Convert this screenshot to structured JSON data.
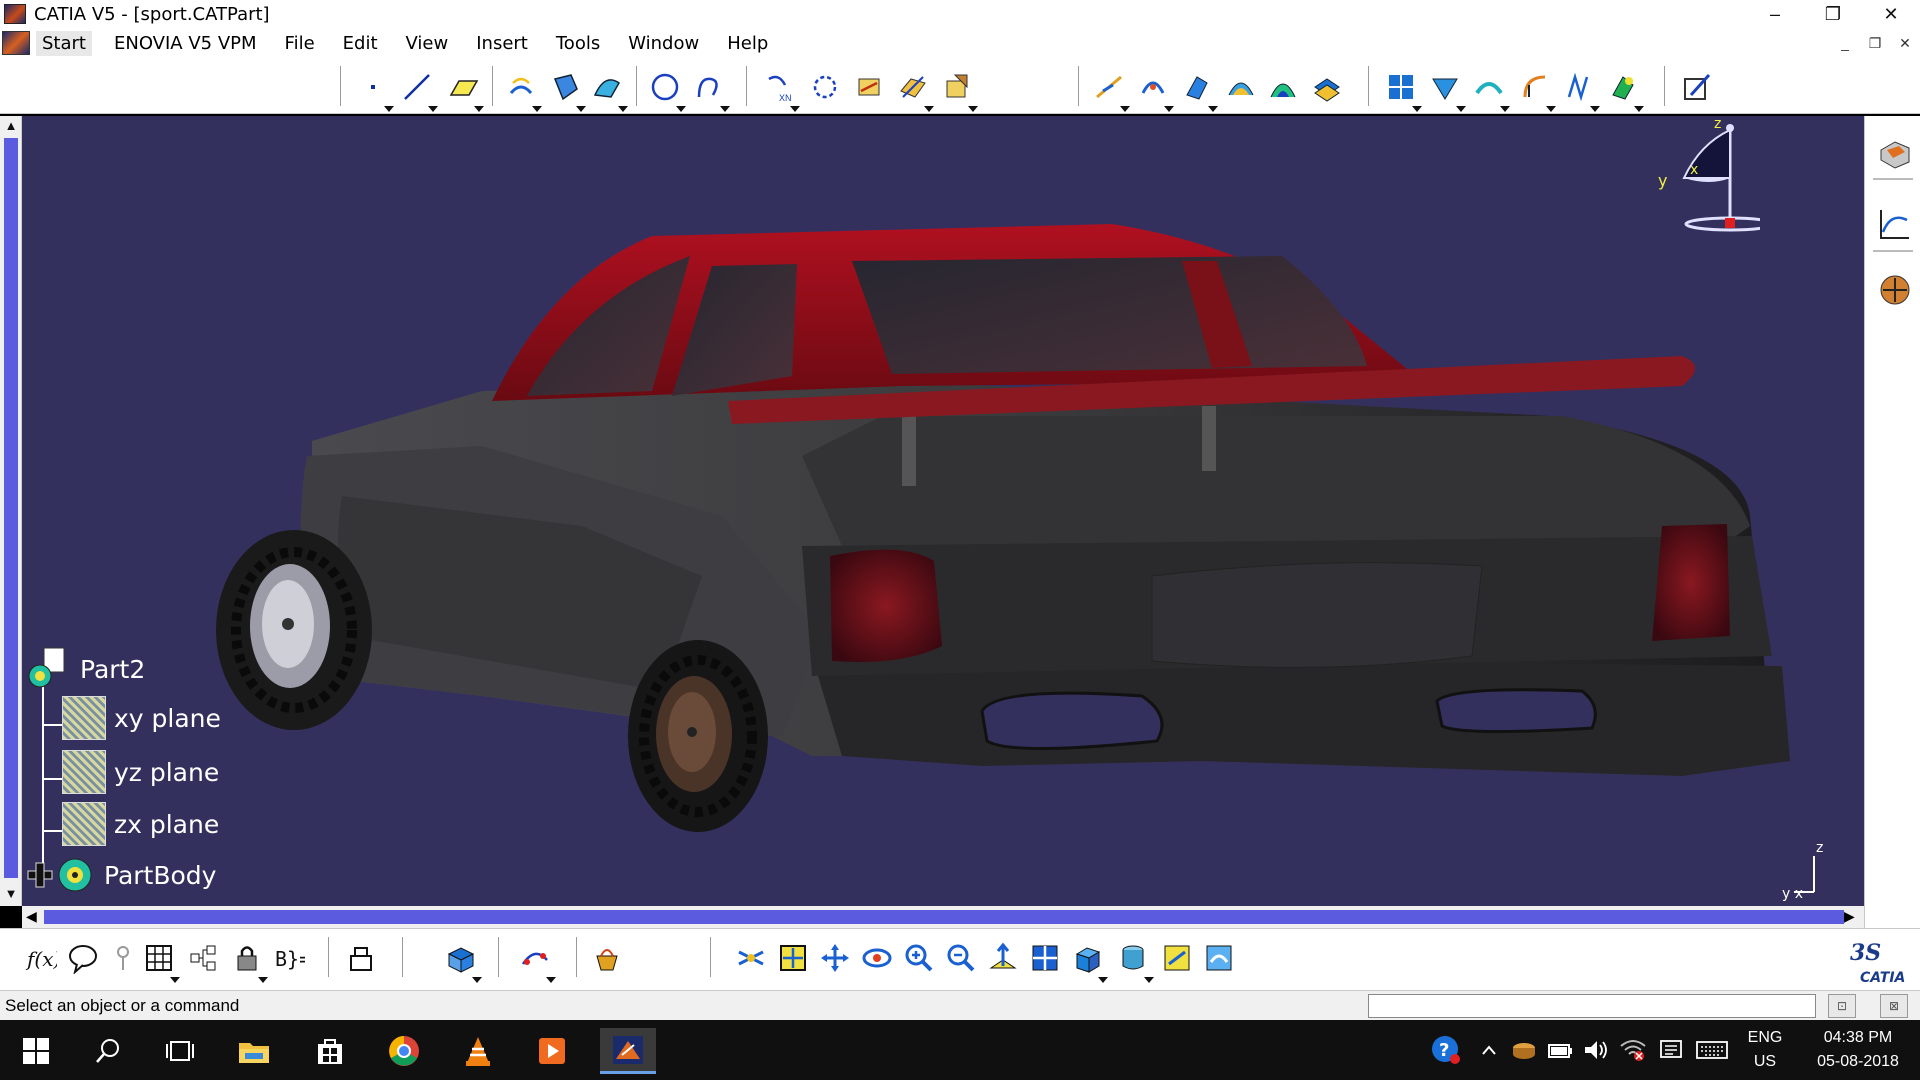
{
  "window": {
    "title": "CATIA V5 - [sport.CATPart]",
    "minimize": "–",
    "restore": "❐",
    "close": "✕"
  },
  "menu": {
    "items": [
      "Start",
      "ENOVIA V5 VPM",
      "File",
      "Edit",
      "View",
      "Insert",
      "Tools",
      "Window",
      "Help"
    ],
    "mdi_minimize": "_",
    "mdi_restore": "❐",
    "mdi_close": "✕"
  },
  "tree": {
    "root": "Part2",
    "children": [
      "xy plane",
      "yz plane",
      "zx plane",
      "PartBody"
    ]
  },
  "compass": {
    "z": "z",
    "y": "y",
    "x": "x"
  },
  "mini_axis": {
    "z": "z",
    "yx": "y x"
  },
  "status": {
    "message": "Select an object or a command",
    "command_value": ""
  },
  "taskbar": {
    "language_top": "ENG",
    "language_bottom": "US",
    "time": "04:38 PM",
    "date": "05-08-2018"
  },
  "colors": {
    "viewport_bg": "#34305e",
    "car_body": "#3c3c3e",
    "car_roof": "#8a0c14",
    "scroll_thumb": "#5b5be0"
  }
}
